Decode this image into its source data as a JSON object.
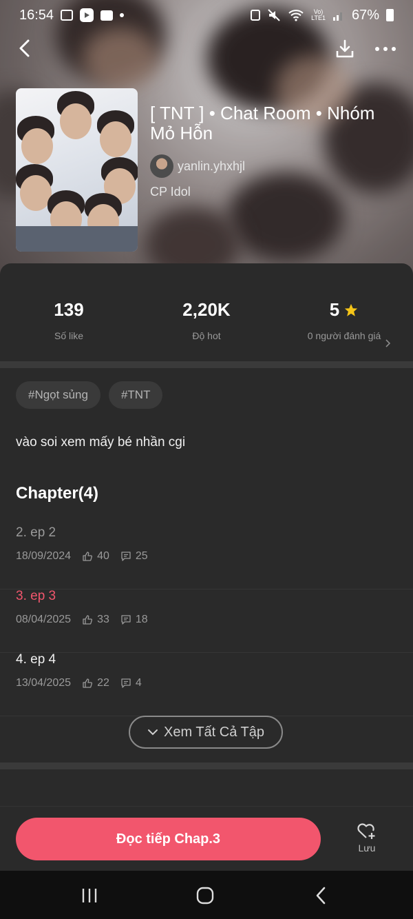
{
  "status_bar": {
    "time": "16:54",
    "battery": "67%"
  },
  "story": {
    "title": "[ TNT ] • Chat Room • Nhóm Mỏ Hỗn",
    "author": "yanlin.yhxhjl",
    "category": "CP Idol"
  },
  "stats": {
    "likes": {
      "value": "139",
      "label": "Số like"
    },
    "hot": {
      "value": "2,20K",
      "label": "Độ hot"
    },
    "rating": {
      "value": "5",
      "label": "0 người đánh giá"
    }
  },
  "tags": [
    "#Ngọt sủng",
    "#TNT"
  ],
  "description": "vào soi xem mấy bé nhần cgi",
  "chapters_header": "Chapter(4)",
  "chapters": [
    {
      "name": "2. ep 2",
      "date": "18/09/2024",
      "likes": "40",
      "comments": "25",
      "state": "read"
    },
    {
      "name": "3. ep 3",
      "date": "08/04/2025",
      "likes": "33",
      "comments": "18",
      "state": "current"
    },
    {
      "name": "4. ep 4",
      "date": "13/04/2025",
      "likes": "22",
      "comments": "4",
      "state": "unread"
    }
  ],
  "view_all_label": "Xem Tất Cả Tập",
  "read_button_label": "Đọc tiếp Chap.3",
  "save_label": "Lưu",
  "colors": {
    "accent": "#f2566d",
    "background": "#2a2a2a",
    "star": "#f5c518"
  }
}
